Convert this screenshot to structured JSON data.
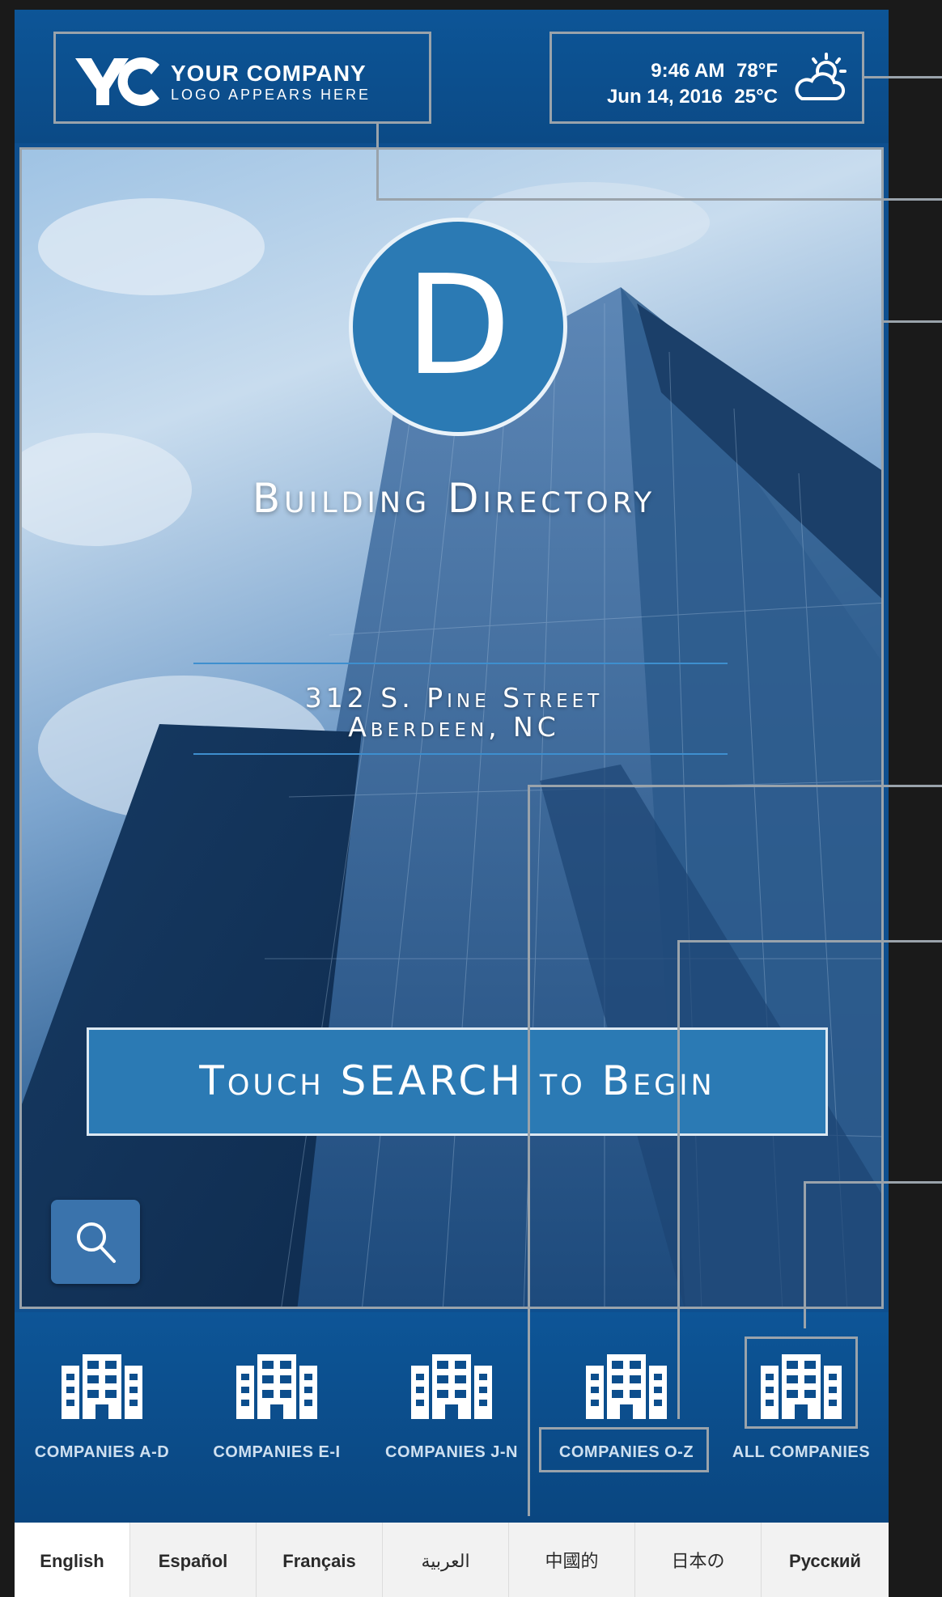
{
  "header": {
    "logo_mark": "YC",
    "logo_company": "YOUR COMPANY",
    "logo_sub": "LOGO APPEARS HERE",
    "time": "9:46 AM",
    "temp_f": "78°F",
    "date": "Jun 14, 2016",
    "temp_c": "25°C",
    "weather_icon": "partly-cloudy-icon"
  },
  "hero": {
    "badge_letter": "D",
    "title": "Building Directory",
    "address_line1": "312 S. Pine Street",
    "address_line2": "Aberdeen, NC",
    "cta": "Touch SEARCH to Begin",
    "search_icon": "search-icon"
  },
  "categories": [
    {
      "label": "COMPANIES A-D",
      "icon": "building-icon"
    },
    {
      "label": "COMPANIES E-I",
      "icon": "building-icon"
    },
    {
      "label": "COMPANIES J-N",
      "icon": "building-icon"
    },
    {
      "label": "COMPANIES O-Z",
      "icon": "building-icon"
    },
    {
      "label": "ALL COMPANIES",
      "icon": "building-icon"
    }
  ],
  "languages": [
    {
      "label": "English",
      "active": true
    },
    {
      "label": "Español"
    },
    {
      "label": "Français"
    },
    {
      "label": "العربية"
    },
    {
      "label": "中國的"
    },
    {
      "label": "日本の"
    },
    {
      "label": "Русский"
    }
  ],
  "colors": {
    "brand_blue": "#0e4f8f",
    "accent_blue": "#2b7ab4",
    "callout_gray": "#9aa3ab"
  }
}
